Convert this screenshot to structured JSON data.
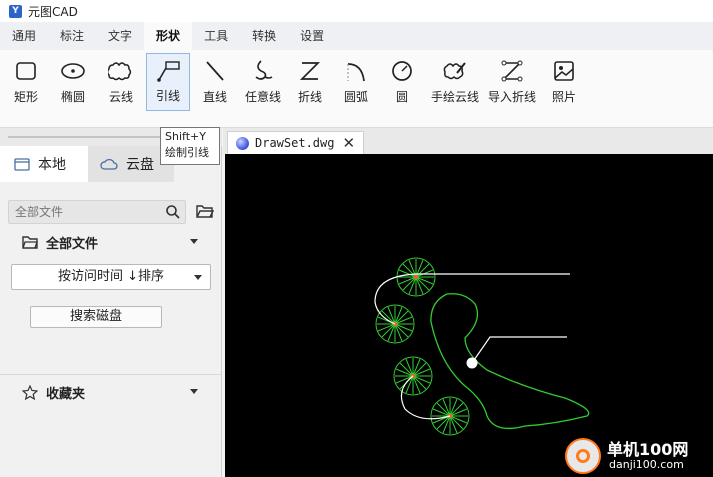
{
  "app": {
    "title": "元图CAD"
  },
  "menu": {
    "tabs": [
      {
        "label": "通用"
      },
      {
        "label": "标注"
      },
      {
        "label": "文字"
      },
      {
        "label": "形状"
      },
      {
        "label": "工具"
      },
      {
        "label": "转换"
      },
      {
        "label": "设置"
      }
    ],
    "active_index": 3
  },
  "ribbon": {
    "tools": [
      {
        "label": "矩形",
        "icon": "rectangle-icon"
      },
      {
        "label": "椭圆",
        "icon": "ellipse-icon"
      },
      {
        "label": "云线",
        "icon": "cloud-line-icon"
      },
      {
        "label": "引线",
        "icon": "leader-line-icon"
      },
      {
        "label": "直线",
        "icon": "straight-line-icon"
      },
      {
        "label": "任意线",
        "icon": "freehand-line-icon"
      },
      {
        "label": "折线",
        "icon": "polyline-icon"
      },
      {
        "label": "圆弧",
        "icon": "arc-icon"
      },
      {
        "label": "圆",
        "icon": "circle-icon"
      },
      {
        "label": "手绘云线",
        "icon": "hand-drawn-cloud-icon"
      },
      {
        "label": "导入折线",
        "icon": "import-polyline-icon"
      },
      {
        "label": "照片",
        "icon": "photo-icon"
      }
    ],
    "active_tool": "引线"
  },
  "tooltip": {
    "shortcut": "Shift+Y",
    "description": "绘制引线"
  },
  "sidebar": {
    "tabs": [
      {
        "label": "本地",
        "icon": "local-folder-icon"
      },
      {
        "label": "云盘",
        "icon": "cloud-icon"
      }
    ],
    "search_placeholder": "全部文件",
    "all_files_label": "全部文件",
    "sort_label": "按访问时间 ↓排序",
    "search_disk_label": "搜索磁盘",
    "favorites_label": "收藏夹"
  },
  "document": {
    "tab_label": "DrawSet.dwg"
  },
  "colors": {
    "canvas_bg": "#000000",
    "tree_green": "#33cc33",
    "leader_white": "#ffffff",
    "accent_blue": "#2e63c9"
  },
  "watermark": {
    "name": "单机100网",
    "url": "danji100.com"
  }
}
